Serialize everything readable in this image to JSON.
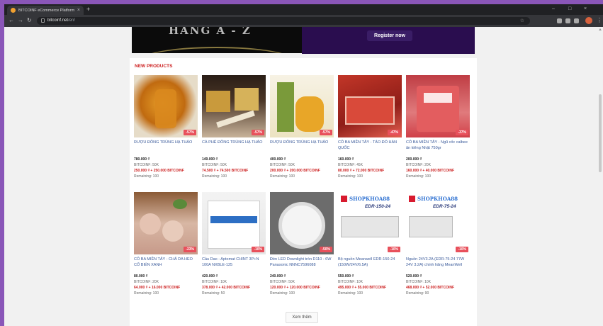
{
  "browser": {
    "tab_title": "BITCOINF eCommerce Platform",
    "url_domain": "bitcoinf.net",
    "url_path": "/en/",
    "new_tab": "+",
    "close_tab": "×",
    "minimize": "–",
    "maximize": "□",
    "close_window": "×"
  },
  "banner": {
    "left_text": "HANG A - Z",
    "register_label": "Register now"
  },
  "section": {
    "title": "NEW PRODUCTS"
  },
  "products": [
    {
      "name": "RƯỢU ĐÔNG TRÙNG HẠ THẢO",
      "price": "780.000 ₫",
      "coin": "BITCOINF: 50K",
      "deal": "250.000 ₫ + 250.000 BITCOINF",
      "remaining": "Remaining: 100",
      "discount": "-57%"
    },
    {
      "name": "CÀ PHÊ ĐÔNG TRÙNG HẠ THẢO",
      "price": "149.000 ₫",
      "coin": "BITCOINF: 50K",
      "deal": "74.500 ₫ + 74.500 BITCOINF",
      "remaining": "Remaining: 100",
      "discount": "-57%"
    },
    {
      "name": "RƯỢU ĐÔNG TRÙNG HẠ THẢO",
      "price": "400.000 ₫",
      "coin": "BITCOINF: 50K",
      "deal": "200.000 ₫ + 200.000 BITCOINF",
      "remaining": "Remaining: 100",
      "discount": "-57%"
    },
    {
      "name": "CÔ BA MIỀN TÂY - TÁO ĐỎ HÀN QUỐC",
      "price": "160.000 ₫",
      "coin": "BITCOINF: 45K",
      "deal": "80.000 ₫ + 72.000 BITCOINF",
      "remaining": "Remaining: 100",
      "discount": "-47%"
    },
    {
      "name": "CÔ BA MIỀN TÂY - Ngũ cốc calbee ăn kiêng Nhật 750gr",
      "price": "200.000 ₫",
      "coin": "BITCOINF: 20K",
      "deal": "160.000 ₫ + 40.000 BITCOINF",
      "remaining": "Remaining: 100",
      "discount": "-37%"
    },
    {
      "name": "CÔ BA MIỀN TÂY - CHẢ DA HEO CỐ BIỂN XANH",
      "price": "80.000 ₫",
      "coin": "BITCOINF: 20K",
      "deal": "64.000 ₫ + 16.000 BITCOINF",
      "remaining": "Remaining: 100",
      "discount": "-23%"
    },
    {
      "name": "Cầu Dao - Aptomat CHINT 3P+N 100A NXBLE-125",
      "price": "420.000 ₫",
      "coin": "BITCOINF: 10K",
      "deal": "378.000 ₫ + 42.000 BITCOINF",
      "remaining": "Remaining: 50",
      "discount": "-10%"
    },
    {
      "name": "Đèn LED Downlight tròn D110 - 6W Panasonic NNNC7596088",
      "price": "240.000 ₫",
      "coin": "BITCOINF: 50K",
      "deal": "120.000 ₫ + 120.000 BITCOINF",
      "remaining": "Remaining: 100",
      "discount": "-50%"
    },
    {
      "name": "Bộ nguồn Meanwell EDR-150-24 (150W/24V/6.5A)",
      "price": "550.000 ₫",
      "coin": "BITCOINF: 10K",
      "deal": "495.000 ₫ + 55.000 BITCOINF",
      "remaining": "Remaining: 100",
      "discount": "-10%",
      "shop": "SHOPKHOA88",
      "model": "EDR-150-24"
    },
    {
      "name": "Nguồn 24V3.2A (EDR-75-24 77W 24V 3.2A) chính hãng MeanWell",
      "price": "520.000 ₫",
      "coin": "BITCOINF: 10K",
      "deal": "468.000 ₫ + 52.000 BITCOINF",
      "remaining": "Remaining: 90",
      "discount": "-10%",
      "shop": "SHOPKHOA88",
      "model": "EDR-75-24"
    }
  ],
  "more_label": "Xem thêm",
  "colors": {
    "accent_red": "#cc1f1f",
    "link_blue": "#3a5a9a",
    "discount_badge": "#e8505b",
    "banner_purple": "#2a0d4f"
  }
}
